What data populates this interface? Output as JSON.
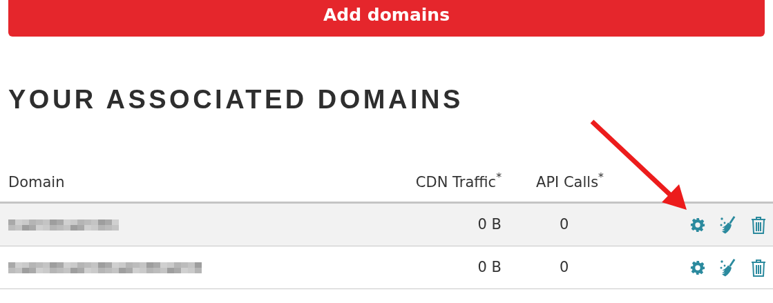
{
  "add_button": {
    "label": "Add domains"
  },
  "heading": "YOUR ASSOCIATED DOMAINS",
  "table": {
    "columns": [
      "Domain",
      "CDN Traffic$^{*}$",
      "API Calls$^{*}$"
    ],
    "rows": [
      {
        "highlighted": true,
        "cdn_traffic": "0 B",
        "api_calls": "0"
      },
      {
        "highlighted": false,
        "cdn_traffic": "0 B",
        "api_calls": "0"
      }
    ]
  }
}
